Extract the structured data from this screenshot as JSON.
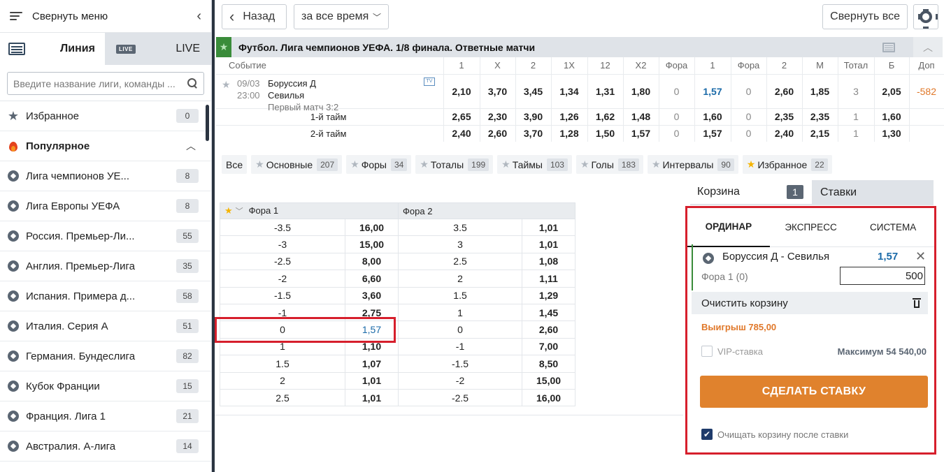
{
  "sidebar": {
    "collapse_label": "Свернуть меню",
    "tab_line": "Линия",
    "live_badge": "LIVE",
    "tab_live": "LIVE",
    "search_placeholder": "Введите название лиги, команды ...",
    "favorites": {
      "label": "Избранное",
      "count": "0"
    },
    "popular": {
      "label": "Популярное"
    },
    "leagues": [
      {
        "label": "Лига чемпионов УЕ...",
        "count": "8"
      },
      {
        "label": "Лига Европы УЕФА",
        "count": "8"
      },
      {
        "label": "Россия. Премьер-Ли...",
        "count": "55"
      },
      {
        "label": "Англия. Премьер-Лига",
        "count": "35"
      },
      {
        "label": "Испания. Примера д...",
        "count": "58"
      },
      {
        "label": "Италия. Серия А",
        "count": "51"
      },
      {
        "label": "Германия. Бундеслига",
        "count": "82"
      },
      {
        "label": "Кубок Франции",
        "count": "15"
      },
      {
        "label": "Франция. Лига 1",
        "count": "21"
      },
      {
        "label": "Австралия. А-лига",
        "count": "14"
      }
    ]
  },
  "topbar": {
    "back_label": "Назад",
    "period_value": "за все время",
    "collapse_all_label": "Свернуть все"
  },
  "league": {
    "title": "Футбол. Лига чемпионов УЕФА. 1/8 финала. Ответные матчи"
  },
  "market": {
    "columns": [
      "Событие",
      "1",
      "X",
      "2",
      "1X",
      "12",
      "X2",
      "Фора",
      "1",
      "Фора",
      "2",
      "М",
      "Тотал",
      "Б",
      "Доп"
    ],
    "event": {
      "date": "09/03",
      "time": "23:00",
      "team1": "Боруссия Д",
      "team2": "Севилья",
      "note": "Первый матч 3:2",
      "tv": "TV",
      "odds": [
        "2,10",
        "3,70",
        "3,45",
        "1,34",
        "1,31",
        "1,80",
        "0",
        "1,57",
        "0",
        "2,60",
        "1,85",
        "3",
        "2,05",
        "-582"
      ]
    },
    "halves": [
      {
        "name": "1-й тайм",
        "odds": [
          "2,65",
          "2,30",
          "3,90",
          "1,26",
          "1,62",
          "1,48",
          "0",
          "1,60",
          "0",
          "2,35",
          "2,35",
          "1",
          "1,60",
          ""
        ]
      },
      {
        "name": "2-й тайм",
        "odds": [
          "2,40",
          "2,60",
          "3,70",
          "1,28",
          "1,50",
          "1,57",
          "0",
          "1,57",
          "0",
          "2,40",
          "2,15",
          "1",
          "1,30",
          ""
        ]
      }
    ]
  },
  "filters": [
    {
      "label": "Все",
      "count": ""
    },
    {
      "label": "Основные",
      "count": "207"
    },
    {
      "label": "Форы",
      "count": "34"
    },
    {
      "label": "Тоталы",
      "count": "199"
    },
    {
      "label": "Таймы",
      "count": "103"
    },
    {
      "label": "Голы",
      "count": "183"
    },
    {
      "label": "Интервалы",
      "count": "90"
    },
    {
      "label": "Избранное",
      "count": "22"
    }
  ],
  "handicap": {
    "header1": "Фора 1",
    "header2": "Фора 2",
    "rows": [
      [
        "-3.5",
        "16,00",
        "3.5",
        "1,01"
      ],
      [
        "-3",
        "15,00",
        "3",
        "1,01"
      ],
      [
        "-2.5",
        "8,00",
        "2.5",
        "1,08"
      ],
      [
        "-2",
        "6,60",
        "2",
        "1,11"
      ],
      [
        "-1.5",
        "3,60",
        "1.5",
        "1,29"
      ],
      [
        "-1",
        "2,75",
        "1",
        "1,45"
      ],
      [
        "0",
        "1,57",
        "0",
        "2,60"
      ],
      [
        "1",
        "1,10",
        "-1",
        "7,00"
      ],
      [
        "1.5",
        "1,07",
        "-1.5",
        "8,50"
      ],
      [
        "2",
        "1,01",
        "-2",
        "15,00"
      ],
      [
        "2.5",
        "1,01",
        "-2.5",
        "16,00"
      ]
    ]
  },
  "slip": {
    "tab_basket": "Корзина",
    "basket_count": "1",
    "tab_bets": "Ставки",
    "bet_types": [
      "ОРДИНАР",
      "ЭКСПРЕСС",
      "СИСТЕМА"
    ],
    "match": "Боруссия Д - Севилья",
    "coef": "1,57",
    "market": "Фора 1 (0)",
    "stake": "500",
    "clear_label": "Очистить корзину",
    "win_label": "Выигрыш 785,00",
    "vip_label": "VIP-ставка",
    "max_label": "Максимум 54 540,00",
    "make_bet_label": "СДЕЛАТЬ СТАВКУ",
    "clear_after_label": "Очищать корзину после ставки"
  },
  "colors": {
    "accent_orange": "#e0822d",
    "highlight_red": "#d61f2c",
    "coef_blue": "#1a6aa8",
    "fav_green": "#3a8c3a"
  }
}
